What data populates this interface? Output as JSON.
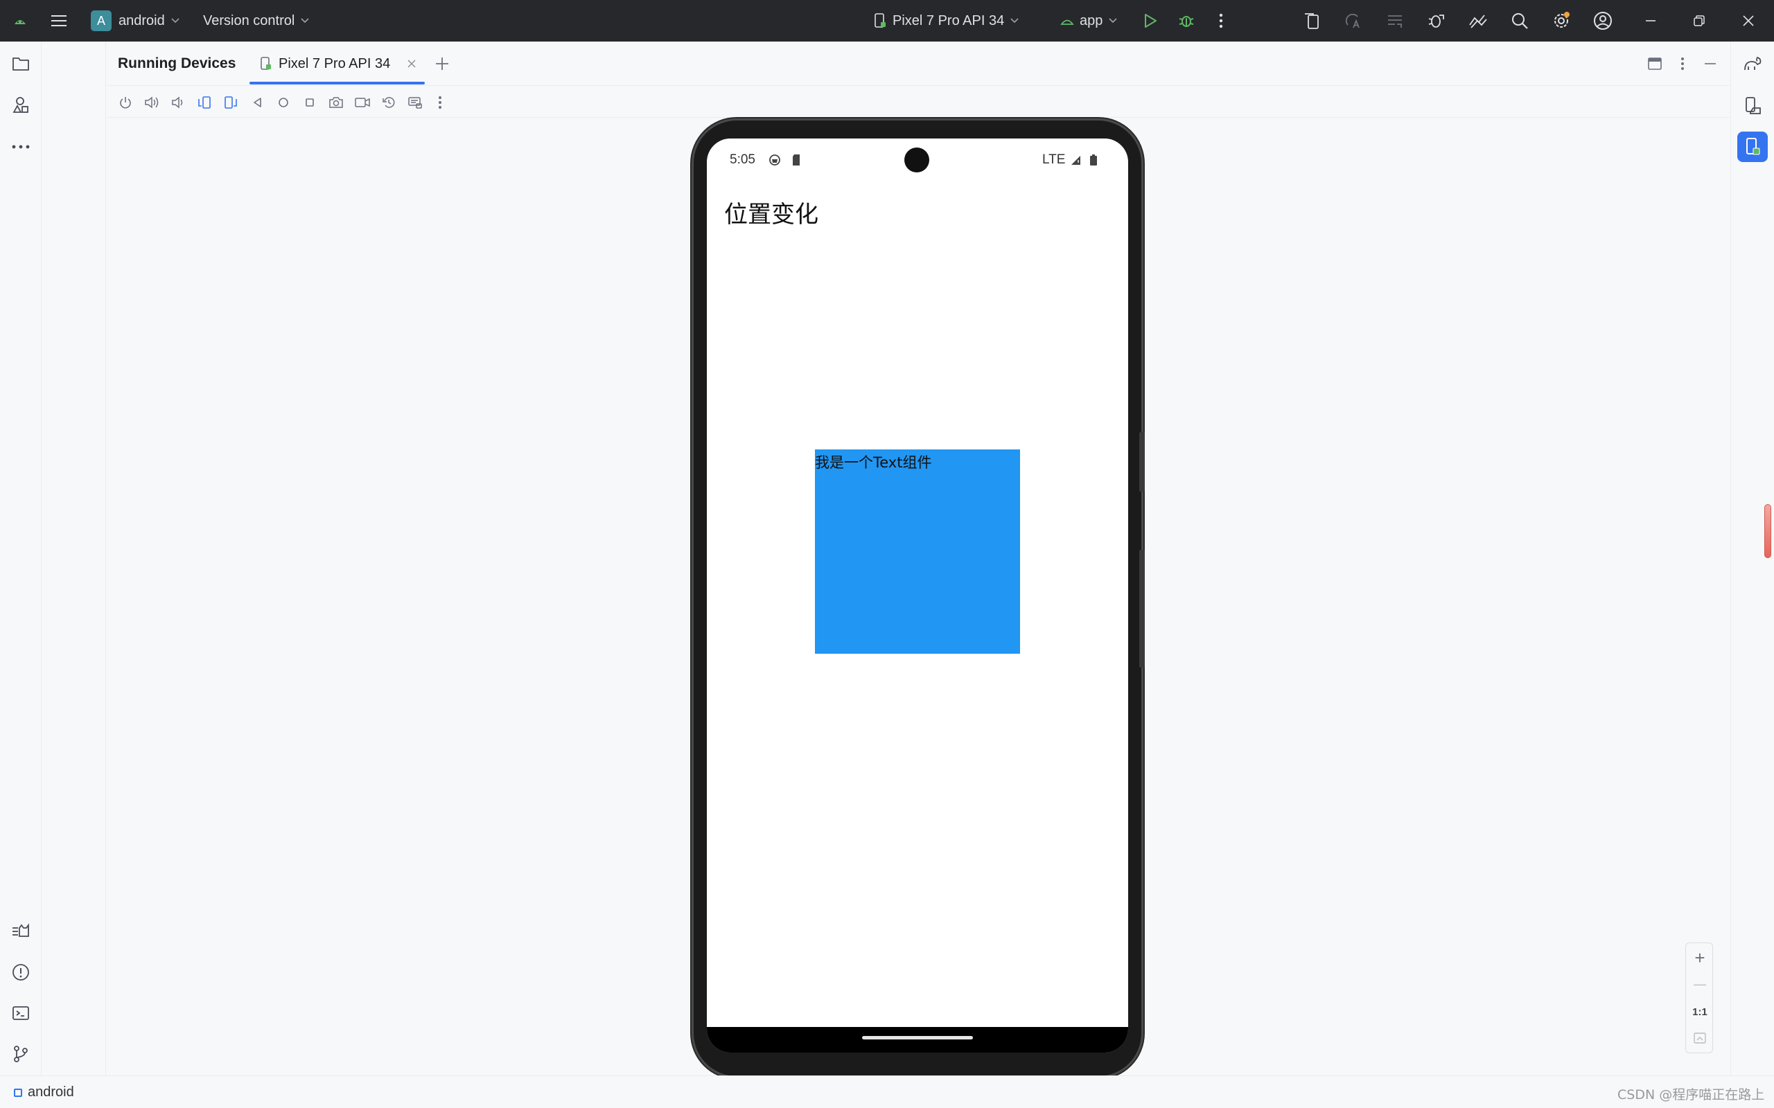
{
  "titlebar": {
    "project_initial": "A",
    "project_name": "android",
    "vcs_label": "Version control",
    "device_selector": "Pixel 7 Pro API 34",
    "run_config": "app"
  },
  "tool_window": {
    "title": "Running Devices",
    "device_tab": "Pixel 7 Pro API 34"
  },
  "emulator": {
    "status_time": "5:05",
    "network_label": "LTE",
    "app_title": "位置变化",
    "box_text": "我是一个Text组件",
    "box_color": "#2196f3"
  },
  "zoom": {
    "plus": "+",
    "minus": "—",
    "one_to_one": "1:1"
  },
  "status_bar": {
    "project": "android",
    "watermark": "CSDN @程序喵正在路上"
  },
  "colors": {
    "titlebar_bg": "#27282c",
    "accent": "#3574f0",
    "run_green": "#5fb865",
    "ide_bg": "#f7f8fa"
  }
}
